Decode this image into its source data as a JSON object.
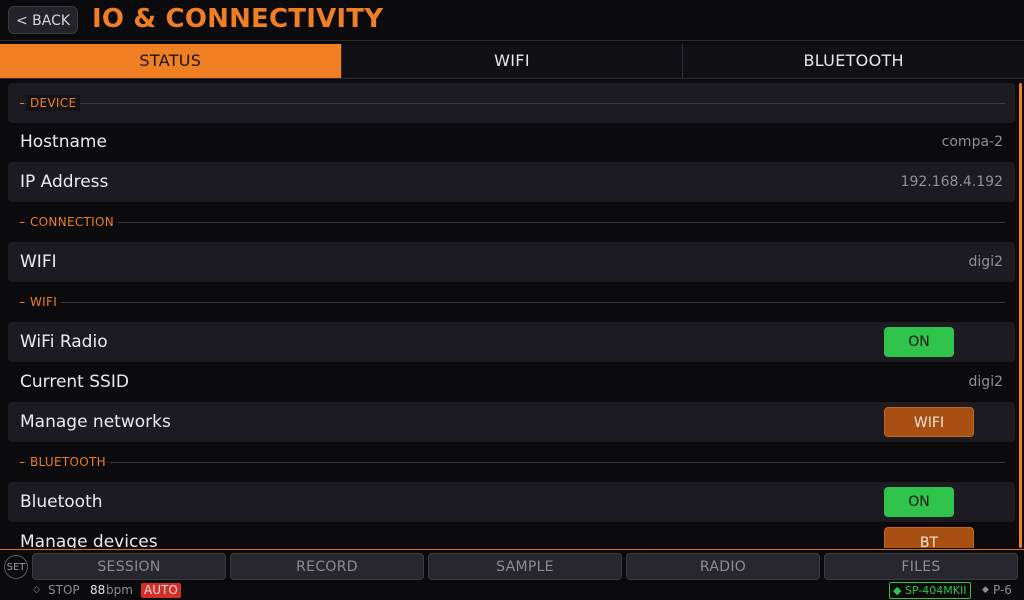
{
  "header": {
    "back_label": "< BACK",
    "title": "IO & CONNECTIVITY"
  },
  "tabs": [
    {
      "label": "STATUS",
      "active": true
    },
    {
      "label": "WIFI",
      "active": false
    },
    {
      "label": "BLUETOOTH",
      "active": false
    }
  ],
  "sections": {
    "device": "DEVICE",
    "connection": "CONNECTION",
    "wifi": "WIFI",
    "bluetooth": "BLUETOOTH"
  },
  "rows": {
    "hostname": {
      "label": "Hostname",
      "value": "compa-2"
    },
    "ip": {
      "label": "IP Address",
      "value": "192.168.4.192"
    },
    "wifi_conn": {
      "label": "WIFI",
      "value": "digi2"
    },
    "wifi_radio": {
      "label": "WiFi Radio",
      "button": "ON"
    },
    "current_ssid": {
      "label": "Current SSID",
      "value": "digi2"
    },
    "manage_networks": {
      "label": "Manage networks",
      "button": "WIFI"
    },
    "bluetooth": {
      "label": "Bluetooth",
      "button": "ON"
    },
    "manage_devices": {
      "label": "Manage devices",
      "button": "BT"
    }
  },
  "bottom_nav": {
    "set_label": "SET",
    "buttons": [
      "SESSION",
      "RECORD",
      "SAMPLE",
      "RADIO",
      "FILES"
    ]
  },
  "status_bar": {
    "transport": "STOP",
    "bpm_value": "88",
    "bpm_unit": "bpm",
    "mode_badge": "AUTO",
    "device": "SP-404MKII",
    "pattern": "P-6"
  },
  "colors": {
    "accent": "#ef7f22",
    "on_green": "#2fc34b",
    "orange_button": "#a84f14",
    "auto_red": "#d0302b"
  }
}
